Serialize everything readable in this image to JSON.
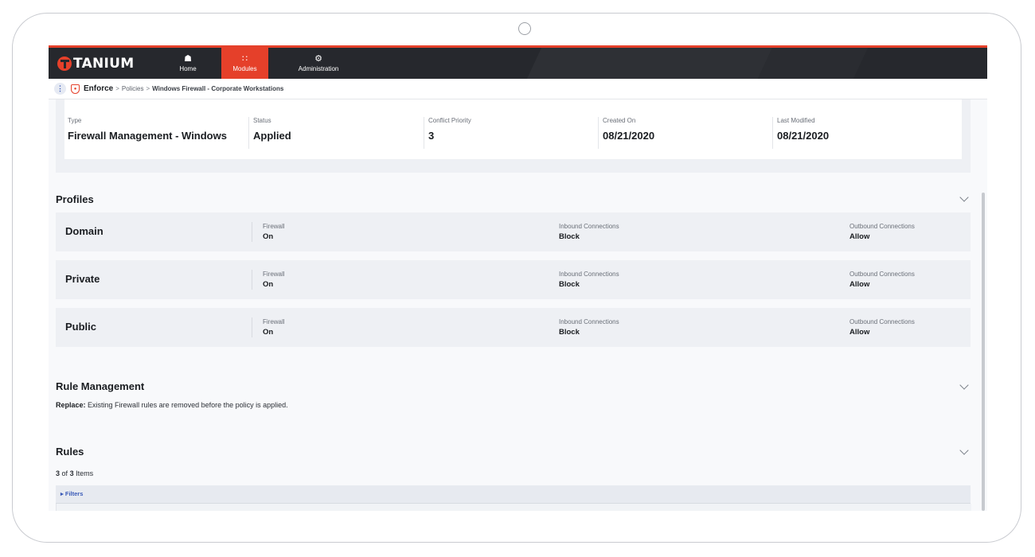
{
  "app": {
    "brand": "TANIUM",
    "accent_color": "#e5402a",
    "nav_bg_color": "#26282d"
  },
  "nav": {
    "items": [
      {
        "label": "Home",
        "icon": "home-icon",
        "active": false
      },
      {
        "label": "Modules",
        "icon": "grid-icon",
        "active": true
      },
      {
        "label": "Administration",
        "icon": "gears-icon",
        "active": false
      }
    ]
  },
  "breadcrumb": {
    "module": "Enforce",
    "separator": ">",
    "parent": "Policies",
    "current": "Windows Firewall - Corporate Workstations"
  },
  "summary": {
    "fields": [
      {
        "label": "Type",
        "value": "Firewall Management - Windows"
      },
      {
        "label": "Status",
        "value": "Applied"
      },
      {
        "label": "Conflict Priority",
        "value": "3"
      },
      {
        "label": "Created On",
        "value": "08/21/2020"
      },
      {
        "label": "Last Modified",
        "value": "08/21/2020"
      }
    ]
  },
  "profiles": {
    "title": "Profiles",
    "items": [
      {
        "name": "Domain",
        "firewall_label": "Firewall",
        "firewall": "On",
        "inbound_label": "Inbound Connections",
        "inbound": "Block",
        "outbound_label": "Outbound Connections",
        "outbound": "Allow"
      },
      {
        "name": "Private",
        "firewall_label": "Firewall",
        "firewall": "On",
        "inbound_label": "Inbound Connections",
        "inbound": "Block",
        "outbound_label": "Outbound Connections",
        "outbound": "Allow"
      },
      {
        "name": "Public",
        "firewall_label": "Firewall",
        "firewall": "On",
        "inbound_label": "Inbound Connections",
        "inbound": "Block",
        "outbound_label": "Outbound Connections",
        "outbound": "Allow"
      }
    ]
  },
  "rule_management": {
    "title": "Rule Management",
    "mode_label": "Replace:",
    "description": "Existing Firewall rules are removed before the policy is applied."
  },
  "rules": {
    "title": "Rules",
    "shown": "3",
    "of_text": "of",
    "total": "3",
    "items_text": "Items",
    "filters_label": "Filters"
  }
}
